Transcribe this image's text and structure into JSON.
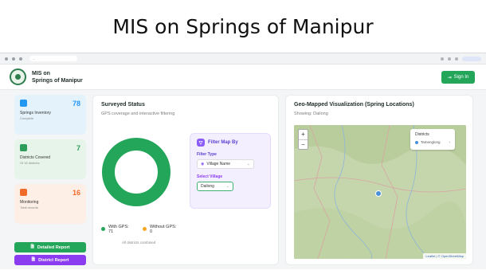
{
  "slide_title": "MIS on Springs of Manipur",
  "browser": {
    "url": "..."
  },
  "app": {
    "brand_line1": "MIS on",
    "brand_line2": "Springs of Manipur",
    "signin_label": "Sign In",
    "signin_icon": "login-icon"
  },
  "stats": [
    {
      "label": "Springs Inventory",
      "sub": "Complete",
      "value": "78",
      "color": "#2196f3",
      "bg": "#e4f2fb"
    },
    {
      "label": "Districts Covered",
      "sub": "Of 16 districts",
      "value": "7",
      "color": "#2e9d5a",
      "bg": "#e7f4ea"
    },
    {
      "label": "Monitoring",
      "sub": "Total records",
      "value": "16",
      "color": "#f06a2c",
      "bg": "#fdeee6"
    }
  ],
  "buttons": {
    "detailed_report": "Detailed Report",
    "district_report": "District Report"
  },
  "surveyed": {
    "title": "Surveyed Status",
    "desc": "GPS coverage and interactive filtering",
    "with_gps": "With GPS:",
    "with_gps_value": "71",
    "without_gps": "Without GPS:",
    "without_gps_value": "0",
    "footnote": "All districts combined",
    "colors": {
      "with": "#23a55a",
      "without": "#f5a623"
    }
  },
  "filter": {
    "heading": "Filter Map By",
    "filter_type_label": "Filter Type",
    "filter_type_value": "Village Name",
    "select_village_label": "Select Village",
    "select_village_value": "Dailong"
  },
  "map": {
    "title": "Geo-Mapped Visualization (Spring Locations)",
    "showing": "Showing: Dailong",
    "zoom_in": "+",
    "zoom_out": "−",
    "legend_title": "Districts",
    "legend_item": "Tamenglong",
    "attribution": "Leaflet | © OpenStreetMap"
  }
}
